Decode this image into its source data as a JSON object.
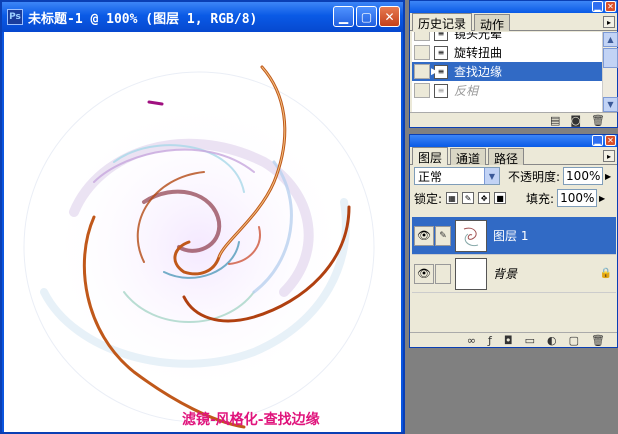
{
  "document": {
    "title": "未标题-1 @ 100% (图层 1, RGB/8)",
    "app_icon": "Ps",
    "caption": "滤镜-风格化-查找边缘"
  },
  "window_buttons": {
    "minimize": "▁",
    "maximize": "▢",
    "close": "✕"
  },
  "history": {
    "tabs": [
      "历史记录",
      "动作"
    ],
    "items": [
      {
        "label": "镜头光晕",
        "state": "normal"
      },
      {
        "label": "旋转扭曲",
        "state": "normal"
      },
      {
        "label": "查找边缘",
        "state": "selected"
      },
      {
        "label": "反相",
        "state": "dim"
      }
    ]
  },
  "layers": {
    "tabs": [
      "图层",
      "通道",
      "路径"
    ],
    "blend_mode": "正常",
    "opacity_label": "不透明度:",
    "opacity_value": "100%",
    "lock_label": "锁定:",
    "fill_label": "填充:",
    "fill_value": "100%",
    "items": [
      {
        "name": "图层 1",
        "selected": true
      },
      {
        "name": "背景",
        "selected": false,
        "locked": true
      }
    ]
  },
  "colors": {
    "accent": "#316ac5",
    "titlebar": "#0a5ae6",
    "caption": "#e0147c"
  }
}
